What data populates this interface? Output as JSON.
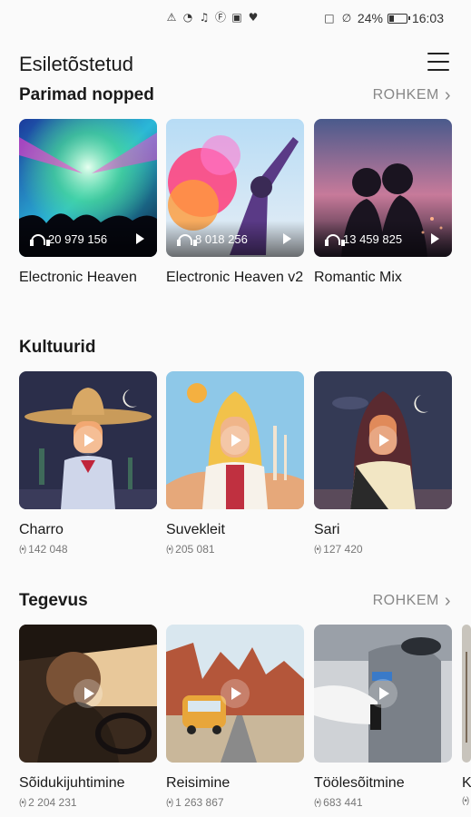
{
  "status_bar": {
    "left_icons": [
      "alert-icon",
      "wifi-icon",
      "music-icon",
      "facebook-icon",
      "instagram-icon",
      "heart-icon"
    ],
    "nfc_icon": "nfc-icon",
    "mute_icon": "bell-off-icon",
    "battery_percent": "24%",
    "battery_level": 0.24,
    "time": "16:03"
  },
  "header": {
    "title": "Esiletõstetud",
    "menu_icon": "hamburger-menu-icon"
  },
  "sections": {
    "top_picks": {
      "title": "Parimad nopped",
      "more_label": "ROHKEM",
      "items": [
        {
          "title": "Electronic Heaven",
          "listeners": "20 979 156"
        },
        {
          "title": "Electronic Heaven v2",
          "listeners": "8 018 256"
        },
        {
          "title": "Romantic Mix",
          "listeners": "13 459 825"
        }
      ]
    },
    "cultures": {
      "title": "Kultuurid",
      "items": [
        {
          "title": "Charro",
          "listeners": "142 048"
        },
        {
          "title": "Suvekleit",
          "listeners": "205 081"
        },
        {
          "title": "Sari",
          "listeners": "127 420"
        }
      ]
    },
    "activity": {
      "title": "Tegevus",
      "more_label": "ROHKEM",
      "items": [
        {
          "title": "Sõidukijuhtimine",
          "listeners": "2 204 231"
        },
        {
          "title": "Reisimine",
          "listeners": "1 263 867"
        },
        {
          "title": "Töölesõitmine",
          "listeners": "683 441"
        },
        {
          "title": "K",
          "listeners": ""
        }
      ]
    }
  }
}
